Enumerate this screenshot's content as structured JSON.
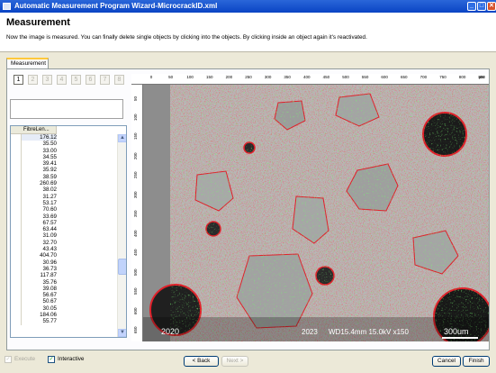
{
  "window": {
    "title": "Automatic Measurement Program Wizard-MicrocrackID.xml",
    "controls": [
      "_",
      "□",
      "✕"
    ]
  },
  "header": {
    "title": "Measurement",
    "description": "Now the image is measured. You can finally delete single objects by clicking into the objects. By clicking inside an object again it's reactivated."
  },
  "tabs": [
    {
      "label": "Measurement",
      "active": true
    }
  ],
  "image_tabs": [
    "1",
    "2",
    "3",
    "4",
    "5",
    "6",
    "7",
    "8"
  ],
  "active_image_tab": "1",
  "table": {
    "column": "FibreLen...",
    "rows": [
      "176.12",
      "35.50",
      "33.00",
      "34.55",
      "39.41",
      "35.92",
      "38.59",
      "260.69",
      "38.02",
      "31.27",
      "53.17",
      "70.60",
      "33.69",
      "67.57",
      "63.44",
      "31.09",
      "32.70",
      "43.43",
      "404.70",
      "30.96",
      "36.73",
      "117.87",
      "35.76",
      "39.08",
      "56.67",
      "50.67",
      "30.05",
      "184.06",
      "55.77"
    ]
  },
  "ruler": {
    "unit": "µm",
    "x_ticks": [
      "0",
      "50",
      "100",
      "150",
      "200",
      "250",
      "300",
      "350",
      "400",
      "450",
      "500",
      "550",
      "600",
      "650",
      "700",
      "750",
      "800",
      "850"
    ],
    "y_ticks": [
      "50",
      "100",
      "150",
      "200",
      "250",
      "300",
      "350",
      "400",
      "450",
      "500",
      "550",
      "600",
      "650"
    ]
  },
  "image_overlay": {
    "text_left": "2020",
    "text_mid": "2023",
    "text_info": "WD15.4mm 15.0kV x150",
    "scalebar": "300um"
  },
  "bottom": {
    "execute": {
      "label": "Execute",
      "checked": true,
      "enabled": false
    },
    "interactive": {
      "label": "Interactive",
      "checked": true,
      "enabled": true
    },
    "back": "< Back",
    "next": "Next >",
    "cancel": "Cancel",
    "finish": "Finish"
  },
  "colors": {
    "titlebar": "#0a44c4",
    "contour_red": "#e0202a",
    "contour_green": "#2ee02a",
    "dialog_bg": "#ece9d8"
  }
}
